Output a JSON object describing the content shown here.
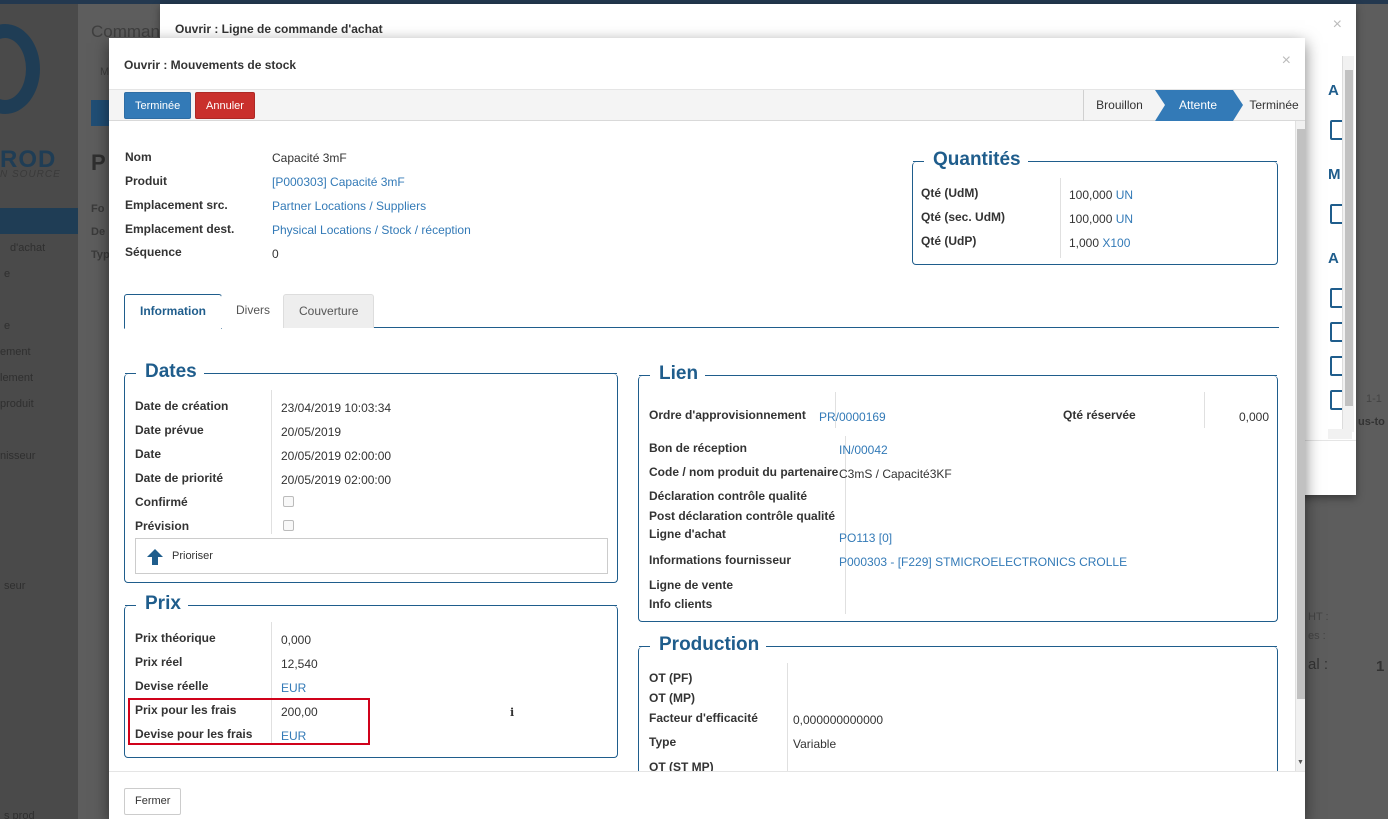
{
  "background": {
    "breadcrumb": "Command",
    "logo_text": "ROD",
    "logo_sub": "N SOURCE",
    "title": "P",
    "sidebar_items": [
      "d'achat",
      "e",
      "e",
      "ement",
      "lement",
      "produit",
      "nisseur",
      "seur",
      "s prod"
    ],
    "left_labels": [
      "Fo",
      "De",
      "Typ"
    ],
    "right_fragments": [
      "1-1",
      "us-to",
      "HT :",
      "es :",
      "al :",
      "1"
    ]
  },
  "back_dialog": {
    "title": "Ouvrir : Ligne de commande d'achat",
    "close": "×",
    "side_letters": [
      "A",
      "M",
      "A"
    ]
  },
  "dialog": {
    "title": "Ouvrir : Mouvements de stock",
    "close": "×",
    "buttons": {
      "done": "Terminée",
      "cancel": "Annuler"
    },
    "steps": [
      "Brouillon",
      "Attente",
      "Terminée"
    ],
    "active_step": "Attente",
    "header_fields": [
      {
        "label": "Nom",
        "value": "Capacité 3mF"
      },
      {
        "label": "Produit",
        "value": "[P000303] Capacité 3mF"
      },
      {
        "label": "Emplacement src.",
        "value": "Partner Locations / Suppliers"
      },
      {
        "label": "Emplacement dest.",
        "value": "Physical Locations / Stock / réception"
      },
      {
        "label": "Séquence",
        "value": "0"
      }
    ],
    "quantites": {
      "title": "Quantités",
      "rows": [
        {
          "label": "Qté (UdM)",
          "value": "100,000",
          "unit": "UN"
        },
        {
          "label": "Qté (sec. UdM)",
          "value": "100,000",
          "unit": "UN"
        },
        {
          "label": "Qté (UdP)",
          "value": "1,000",
          "unit": "X100"
        }
      ]
    },
    "tabs": [
      "Information",
      "Divers",
      "Couverture"
    ],
    "dates": {
      "title": "Dates",
      "rows": [
        {
          "label": "Date de création",
          "value": "23/04/2019 10:03:34"
        },
        {
          "label": "Date prévue",
          "value": "20/05/2019"
        },
        {
          "label": "Date",
          "value": "20/05/2019 02:00:00"
        },
        {
          "label": "Date de priorité",
          "value": "20/05/2019 02:00:00"
        },
        {
          "label": "Confirmé",
          "value": ""
        },
        {
          "label": "Prévision",
          "value": ""
        }
      ],
      "prioritize": "Prioriser"
    },
    "prix": {
      "title": "Prix",
      "rows": [
        {
          "label": "Prix théorique",
          "value": "0,000"
        },
        {
          "label": "Prix réel",
          "value": "12,540"
        },
        {
          "label": "Devise réelle",
          "value": "EUR"
        },
        {
          "label": "Prix pour les frais",
          "value": "200,00"
        },
        {
          "label": "Devise pour les frais",
          "value": "EUR"
        }
      ],
      "info_icon": "i"
    },
    "lien": {
      "title": "Lien",
      "ordre_label": "Ordre d'approvisionnement",
      "ordre_value": "PR/0000169",
      "qte_reservee_label": "Qté réservée",
      "qte_reservee_value": "0,000",
      "rows": [
        {
          "label": "Bon de réception",
          "value": "IN/00042"
        },
        {
          "label": "Code / nom produit du partenaire",
          "value": "C3mS / Capacité3KF"
        },
        {
          "label": "Déclaration contrôle qualité",
          "value": ""
        },
        {
          "label": "Post déclaration contrôle qualité",
          "value": ""
        },
        {
          "label": "Ligne d'achat",
          "value": "PO113 [0]"
        },
        {
          "label": "Informations fournisseur",
          "value": "P000303 - [F229] STMICROELECTRONICS CROLLE"
        },
        {
          "label": "Ligne de vente",
          "value": ""
        },
        {
          "label": "Info clients",
          "value": ""
        }
      ]
    },
    "production": {
      "title": "Production",
      "rows": [
        {
          "label": "OT (PF)",
          "value": ""
        },
        {
          "label": "OT (MP)",
          "value": ""
        },
        {
          "label": "Facteur d'efficacité",
          "value": "0,000000000000"
        },
        {
          "label": "Type",
          "value": "Variable"
        },
        {
          "label": "OT (ST MP)",
          "value": ""
        }
      ]
    },
    "footer_button": "Fermer",
    "colors": {
      "accent": "#1f5d8c",
      "primary": "#337ab7",
      "danger": "#c9302c",
      "highlight": "#d0021b"
    }
  }
}
